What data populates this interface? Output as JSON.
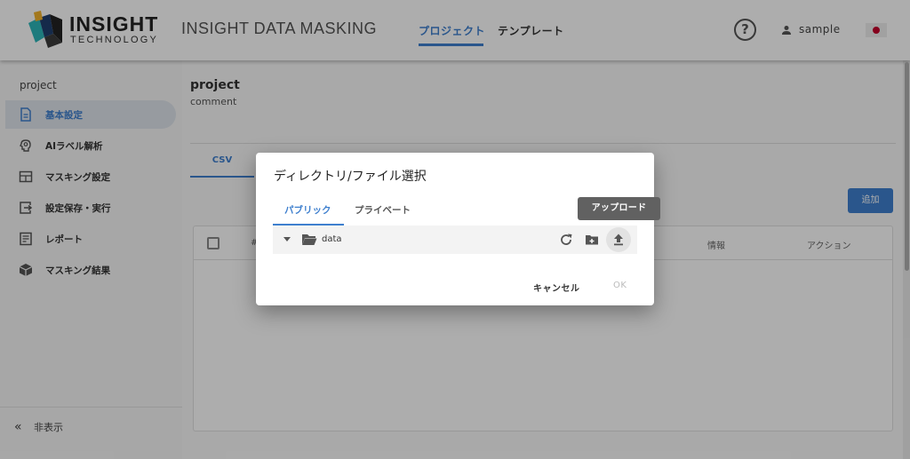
{
  "header": {
    "logo_line1": "INSIGHT",
    "logo_line2": "TECHNOLOGY",
    "app_title": "INSIGHT DATA MASKING",
    "nav": [
      {
        "label": "プロジェクト",
        "active": true
      },
      {
        "label": "テンプレート",
        "active": false
      }
    ],
    "help_symbol": "?",
    "user_name": "sample",
    "icons": {
      "help": "help-circle-icon",
      "user": "person-icon",
      "language": "japan-flag-icon"
    }
  },
  "sidebar": {
    "project_name": "project",
    "items": [
      {
        "label": "基本設定",
        "icon": "document-icon",
        "active": true
      },
      {
        "label": "AIラベル解析",
        "icon": "brain-icon",
        "active": false
      },
      {
        "label": "マスキング設定",
        "icon": "table-icon",
        "active": false
      },
      {
        "label": "設定保存・実行",
        "icon": "export-icon",
        "active": false
      },
      {
        "label": "レポート",
        "icon": "report-icon",
        "active": false
      },
      {
        "label": "マスキング結果",
        "icon": "cube-icon",
        "active": false
      }
    ],
    "hide_label": "非表示",
    "hide_symbol": "«"
  },
  "main": {
    "title": "project",
    "comment": "comment",
    "tab_label": "CSV",
    "add_button_label": "追加",
    "table_columns": [
      "#",
      "情報",
      "アクション"
    ]
  },
  "dialog": {
    "title": "ディレクトリ/ファイル選択",
    "tabs": [
      {
        "label": "パブリック",
        "active": true
      },
      {
        "label": "プライベート",
        "active": false
      }
    ],
    "tree": [
      {
        "name": "data",
        "type": "folder",
        "expanded": false
      }
    ],
    "actions": [
      "refresh-icon",
      "new-folder-icon",
      "upload-icon"
    ],
    "cancel_label": "キャンセル",
    "ok_label": "OK",
    "ok_enabled": false
  },
  "tooltip": {
    "text": "アップロード"
  },
  "colors": {
    "accent": "#3e7fce",
    "tooltip_bg": "#616161",
    "sidebar_active_bg": "#dfe5ec"
  }
}
